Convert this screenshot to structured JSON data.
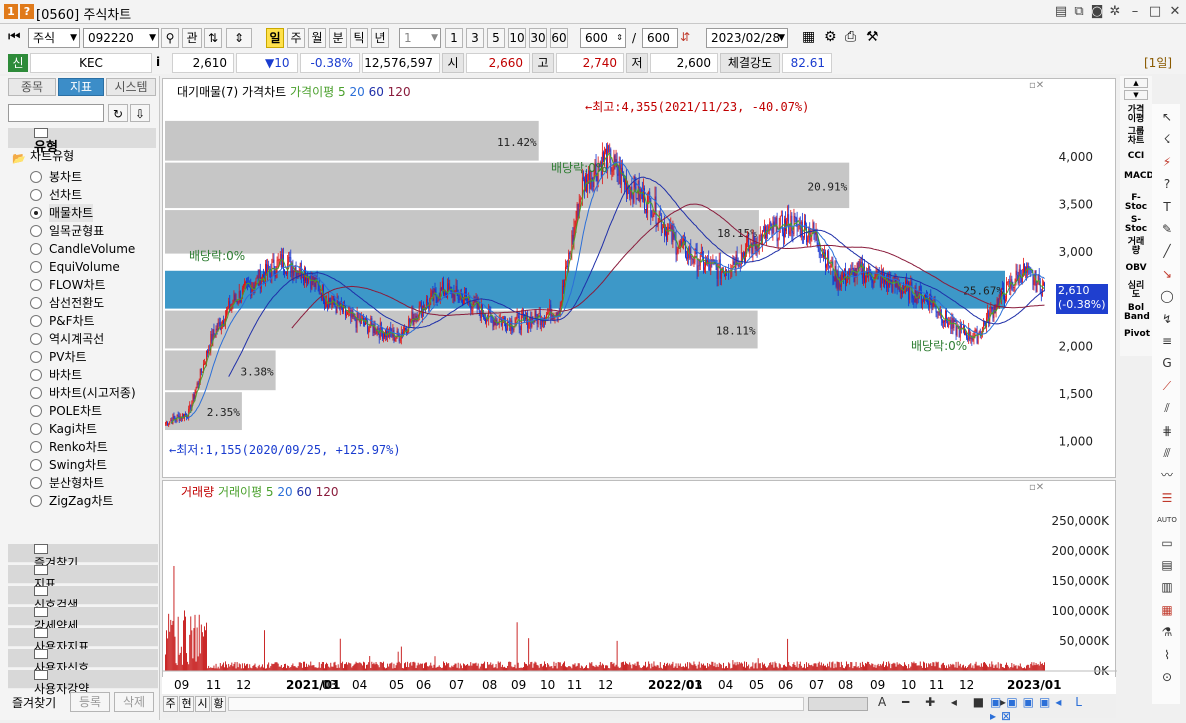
{
  "window": {
    "code_badge": "1",
    "help_badge": "?",
    "title": "[0560] 주식차트"
  },
  "toolbar": {
    "market": "주식",
    "code": "092220",
    "btn_gwan": "관",
    "periods": [
      "일",
      "주",
      "월",
      "분",
      "틱",
      "년"
    ],
    "active_period": "일",
    "interval_value": "1",
    "intervals": [
      "1",
      "3",
      "5",
      "10",
      "30",
      "60"
    ],
    "count1": "600",
    "slash": "/",
    "count2": "600",
    "date": "2023/02/28"
  },
  "quote": {
    "badge": "신",
    "info_icon": "i",
    "name": "KEC",
    "price": "2,610",
    "change": "▼10",
    "change_pct": "-0.38%",
    "volume": "12,576,597",
    "open_label": "시",
    "open": "2,660",
    "high_label": "고",
    "high": "2,740",
    "low_label": "저",
    "low": "2,600",
    "strength_label": "체결강도",
    "strength": "82.61",
    "period_badge": "[1일]"
  },
  "left": {
    "tabs": [
      "종목",
      "지표",
      "시스템"
    ],
    "active_tab": "지표",
    "section": "유형",
    "tree_parent": "차트유형",
    "chart_types": [
      "봉차트",
      "선차트",
      "매물차트",
      "일목균형표",
      "CandleVolume",
      "EquiVolume",
      "FLOW차트",
      "삼선전환도",
      "P&F차트",
      "역시계곡선",
      "PV차트",
      "바차트",
      "바차트(시고저종)",
      "POLE차트",
      "Kagi차트",
      "Renko차트",
      "Swing차트",
      "분산형차트",
      "ZigZag차트"
    ],
    "selected": "매물차트",
    "accordion": [
      "즐겨찾기",
      "지표",
      "신호검색",
      "강세약세",
      "사용자지표",
      "사용자신호",
      "사용자강약"
    ],
    "bottom_buttons": [
      "즐겨찾기",
      "등록",
      "삭제"
    ]
  },
  "price_chart": {
    "legend": [
      {
        "text": "대기매물(7)",
        "color": "#000000"
      },
      {
        "text": "가격차트",
        "color": "#000000"
      },
      {
        "text": "가격이평 5",
        "color": "#4aa02c"
      },
      {
        "text": "20",
        "color": "#2b6fd8"
      },
      {
        "text": "60",
        "color": "#1f2fa8"
      },
      {
        "text": "120",
        "color": "#8a1c3c"
      }
    ],
    "high_annotation": "←최고:4,355(2021/11/23, -40.07%)",
    "low_annotation": "←최저:1,155(2020/09/25, +125.97%)",
    "dividend_label": "배당락:0%",
    "price_tag": "2,610",
    "price_tag_pct": "(-0.38%)"
  },
  "volume_chart": {
    "legend": [
      {
        "text": "거래량",
        "color": "#c00000"
      },
      {
        "text": "거래이평 5",
        "color": "#4aa02c"
      },
      {
        "text": "20",
        "color": "#2b6fd8"
      },
      {
        "text": "60",
        "color": "#1f2fa8"
      },
      {
        "text": "120",
        "color": "#8a1c3c"
      }
    ]
  },
  "chart_data": [
    {
      "type": "candlestick",
      "title": "",
      "y_ticks": [
        "4,000",
        "3,500",
        "3,000",
        "2,500",
        "2,000",
        "1,500",
        "1,000"
      ],
      "ylim": [
        900,
        4400
      ],
      "volume_profile": [
        {
          "range": [
            3940,
            4380
          ],
          "pct": "11.42%"
        },
        {
          "range": [
            3440,
            3940
          ],
          "pct": "20.91%"
        },
        {
          "range": [
            2960,
            3440
          ],
          "pct": "18.15%"
        },
        {
          "range": [
            2380,
            2800
          ],
          "pct": "25.67%"
        },
        {
          "range": [
            1960,
            2380
          ],
          "pct": "18.11%"
        },
        {
          "range": [
            1520,
            1960
          ],
          "pct": "3.38%"
        },
        {
          "range": [
            1100,
            1520
          ],
          "pct": "2.35%"
        }
      ],
      "x_ticks": [
        "09",
        "11",
        "12",
        "2021/01",
        "03",
        "04",
        "05",
        "06",
        "07",
        "08",
        "09",
        "10",
        "11",
        "12",
        "2022/01",
        "03",
        "04",
        "05",
        "06",
        "07",
        "08",
        "09",
        "10",
        "11",
        "12",
        "2023/01"
      ],
      "close_series": [
        1200,
        1300,
        2100,
        2500,
        2700,
        2900,
        2800,
        2500,
        2300,
        2200,
        2100,
        2400,
        2600,
        2500,
        2300,
        2250,
        2300,
        2400,
        3700,
        4000,
        3700,
        3500,
        3100,
        2900,
        2800,
        3000,
        3200,
        3300,
        3200,
        2700,
        2800,
        2700,
        2600,
        2500,
        2200,
        2100,
        2500,
        2800,
        2600
      ]
    },
    {
      "type": "bar",
      "title": "거래량",
      "y_ticks": [
        "250,000K",
        "200,000K",
        "150,000K",
        "100,000K",
        "50,000K",
        "0K"
      ],
      "ylim": [
        0,
        280000
      ],
      "unit": "K"
    }
  ],
  "x_axis_labels": [
    "09",
    "11",
    "12",
    "2021/01",
    "03",
    "04",
    "05",
    "06",
    "07",
    "08",
    "09",
    "10",
    "11",
    "12",
    "2022/01",
    "03",
    "04",
    "05",
    "06",
    "07",
    "08",
    "09",
    "10",
    "11",
    "12",
    "2023/01"
  ],
  "bottom": {
    "scale_buttons": [
      "주",
      "현",
      "시",
      "황"
    ]
  },
  "right_tools": [
    "가격이평",
    "그룹차트",
    "CCI",
    "MACD",
    "F-Stoc",
    "S-Stoc",
    "거래량",
    "OBV",
    "심리도",
    "Bol Band",
    "Pivot"
  ]
}
